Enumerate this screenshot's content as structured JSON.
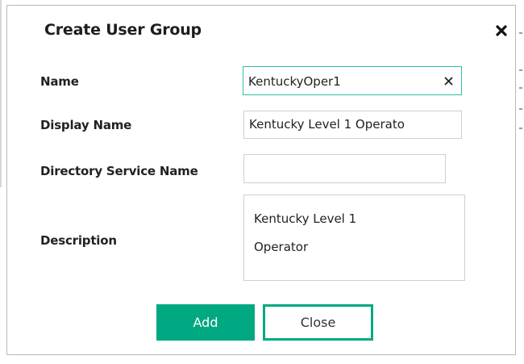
{
  "dialog": {
    "title": "Create User Group",
    "close_icon": "close-icon"
  },
  "form": {
    "name": {
      "label": "Name",
      "value": "KentuckyOper1",
      "clear_icon": "clear-icon"
    },
    "display_name": {
      "label": "Display Name",
      "value": "Kentucky Level 1 Operato"
    },
    "directory_service_name": {
      "label": "Directory Service Name",
      "value": ""
    },
    "description": {
      "label": "Description",
      "line1": "Kentucky Level 1",
      "line2": "Operator"
    }
  },
  "buttons": {
    "add_label": "Add",
    "close_label": "Close"
  },
  "colors": {
    "accent": "#01a982",
    "focus_border": "#32bfa7"
  }
}
